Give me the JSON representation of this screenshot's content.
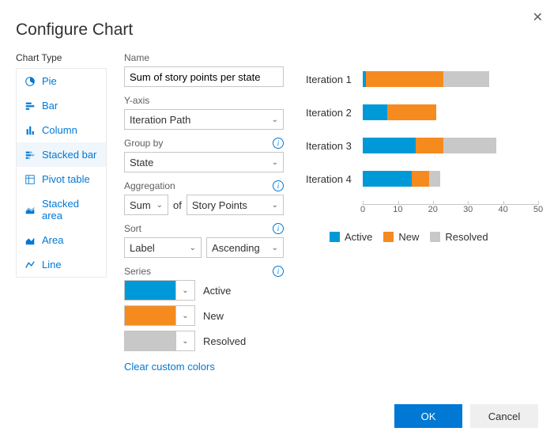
{
  "title": "Configure Chart",
  "close_glyph": "✕",
  "sidebar": {
    "label": "Chart Type",
    "items": [
      {
        "label": "Pie"
      },
      {
        "label": "Bar"
      },
      {
        "label": "Column"
      },
      {
        "label": "Stacked bar"
      },
      {
        "label": "Pivot table"
      },
      {
        "label": "Stacked area"
      },
      {
        "label": "Area"
      },
      {
        "label": "Line"
      }
    ],
    "selected": "Stacked bar"
  },
  "form": {
    "name_label": "Name",
    "name_value": "Sum of story points per state",
    "yaxis_label": "Y-axis",
    "yaxis_value": "Iteration Path",
    "groupby_label": "Group by",
    "groupby_value": "State",
    "aggregation_label": "Aggregation",
    "aggregation_value": "Sum",
    "aggregation_of": "of",
    "aggregation_field": "Story Points",
    "sort_label": "Sort",
    "sort_value": "Label",
    "sort_dir": "Ascending",
    "series_label": "Series",
    "series": [
      {
        "label": "Active",
        "color": "#0099d8"
      },
      {
        "label": "New",
        "color": "#f58b1f"
      },
      {
        "label": "Resolved",
        "color": "#c8c8c8"
      }
    ],
    "clear_colors": "Clear custom colors",
    "info_glyph": "i",
    "chev_glyph": "⌄"
  },
  "footer": {
    "ok": "OK",
    "cancel": "Cancel"
  },
  "chart_data": {
    "type": "bar",
    "orientation": "horizontal",
    "stacked": true,
    "categories": [
      "Iteration 1",
      "Iteration 2",
      "Iteration 3",
      "Iteration 4"
    ],
    "series": [
      {
        "name": "Active",
        "color": "#0099d8",
        "values": [
          1,
          7,
          15,
          14
        ]
      },
      {
        "name": "New",
        "color": "#f58b1f",
        "values": [
          22,
          14,
          8,
          5
        ]
      },
      {
        "name": "Resolved",
        "color": "#c8c8c8",
        "values": [
          13,
          0,
          15,
          3
        ]
      }
    ],
    "xlabel": "",
    "ylabel": "",
    "xlim": [
      0,
      50
    ],
    "ticks": [
      0,
      10,
      20,
      30,
      40,
      50
    ]
  }
}
